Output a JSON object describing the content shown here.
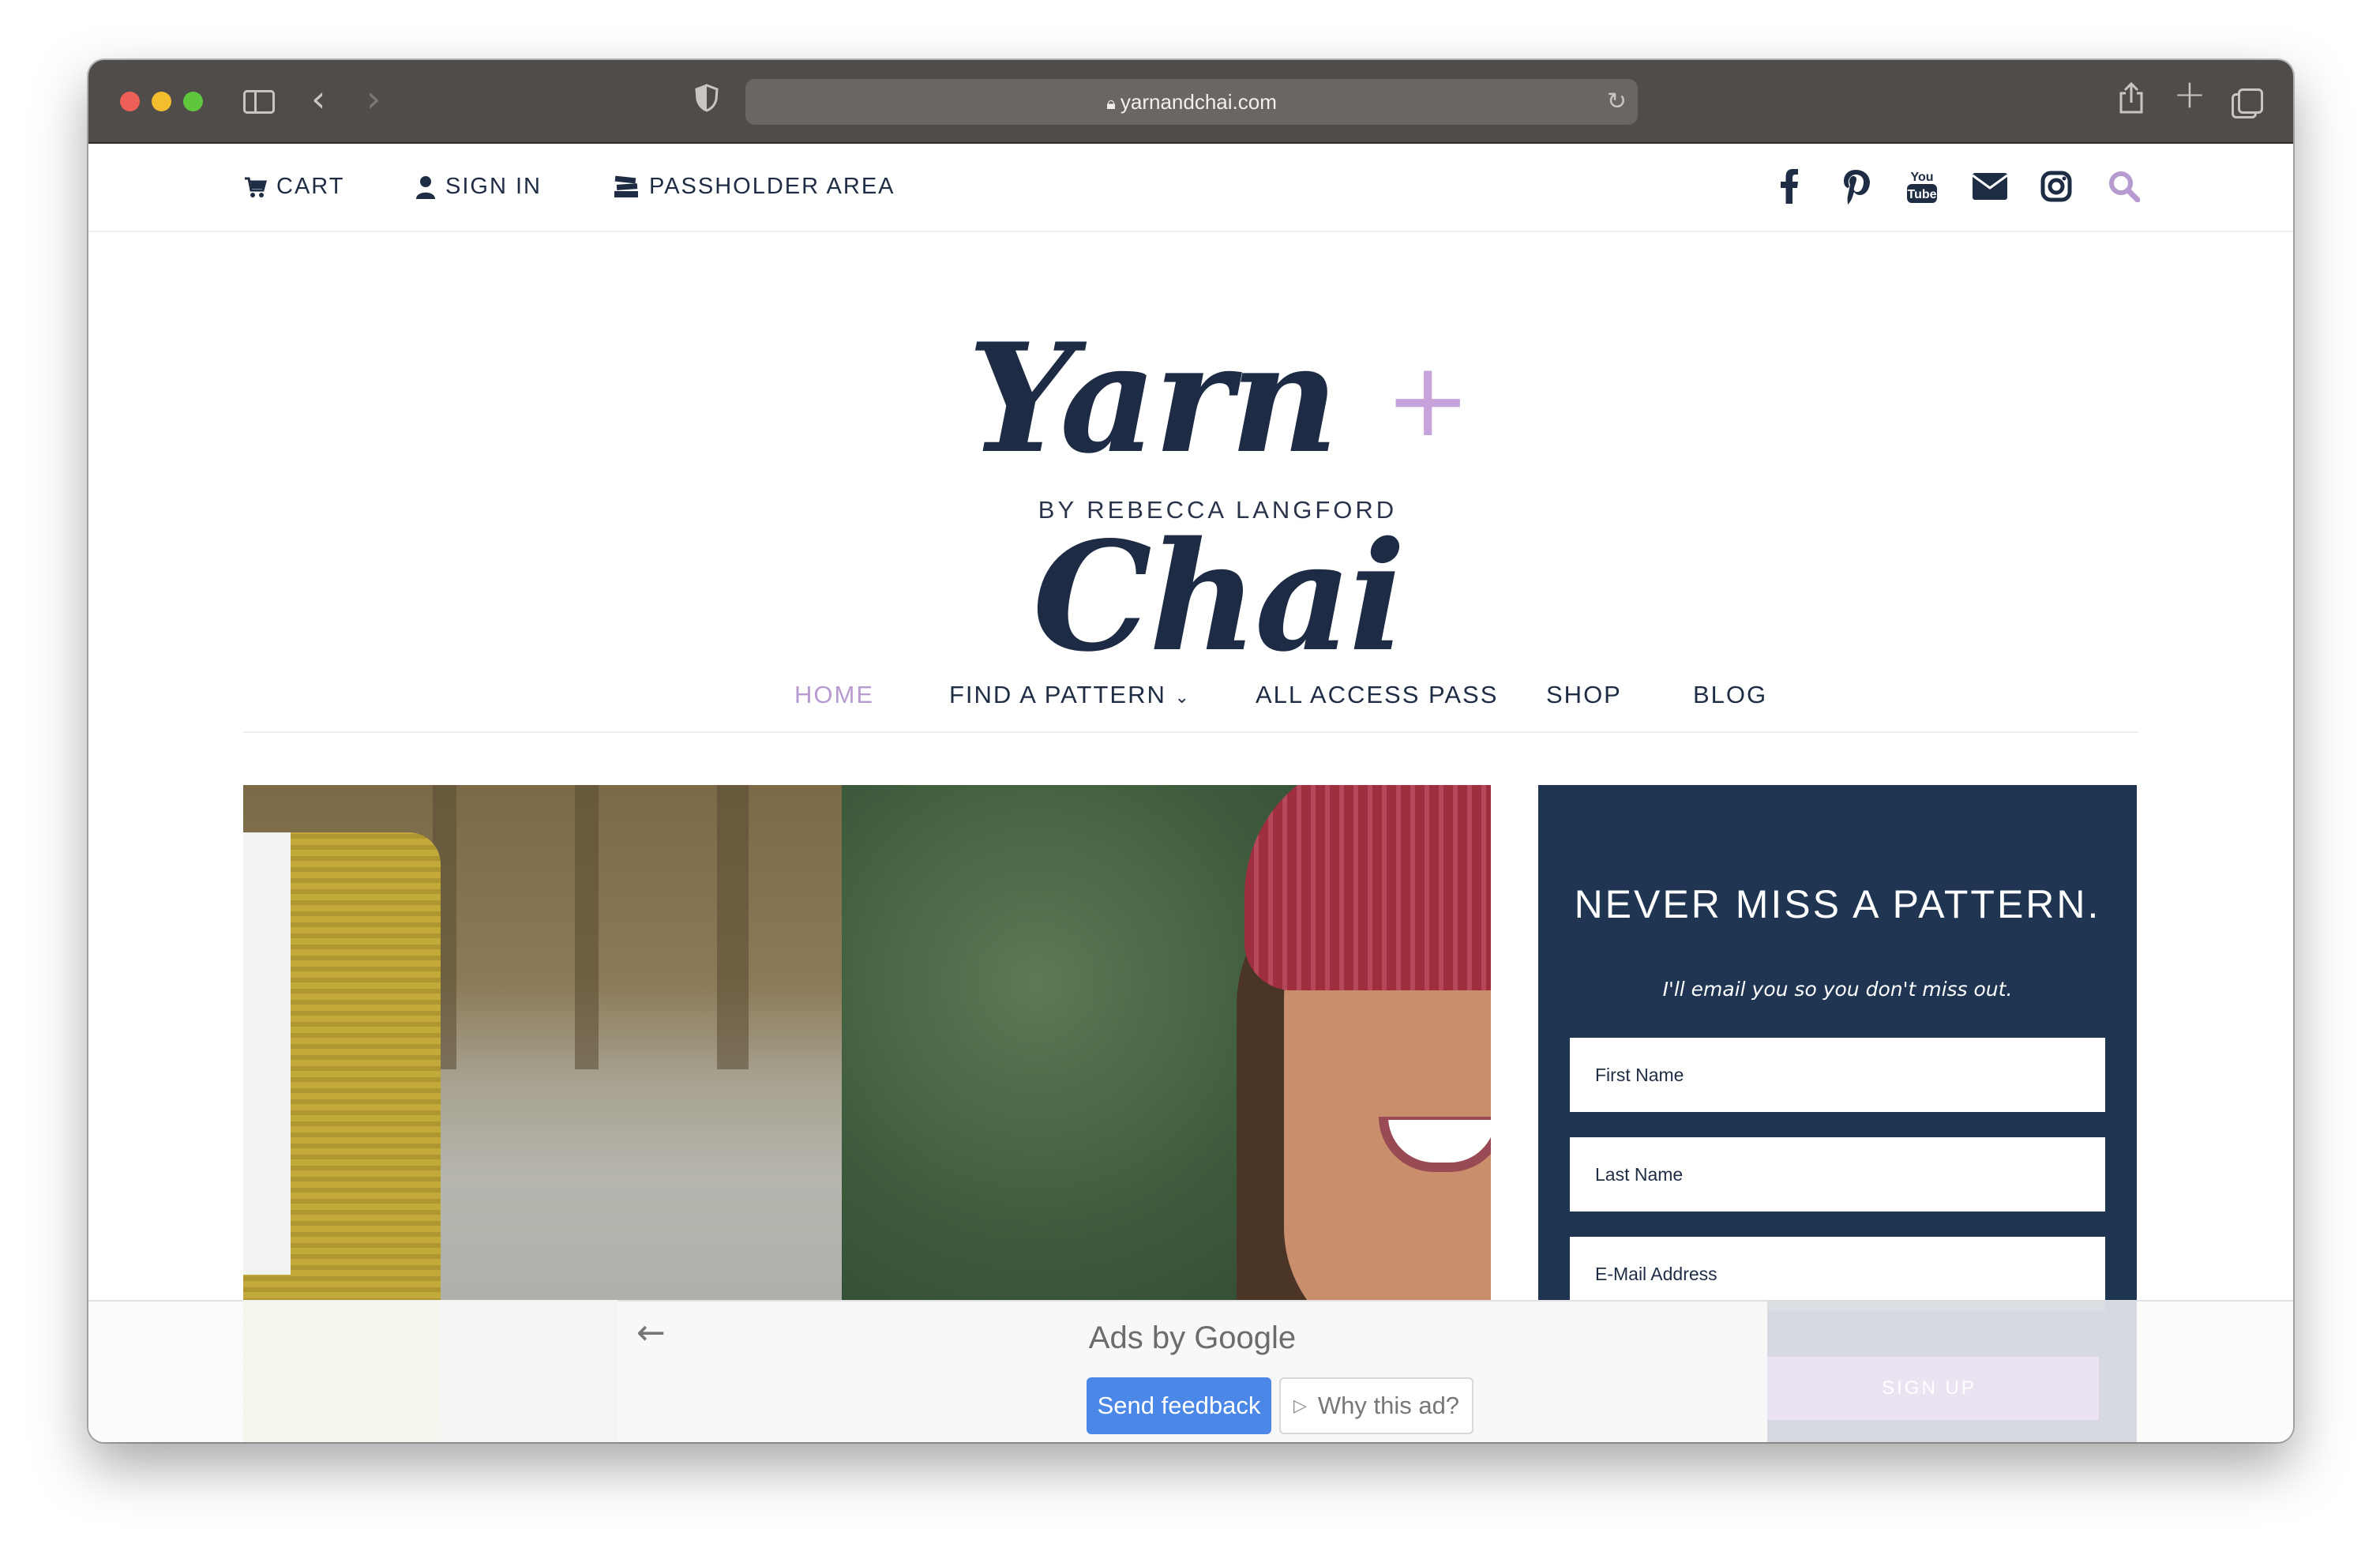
{
  "browser": {
    "url": "yarnandchai.com"
  },
  "topbar": {
    "cart": "CART",
    "sign_in": "SIGN IN",
    "passholder": "PASSHOLDER AREA",
    "social_icons": [
      "facebook-icon",
      "pinterest-icon",
      "youtube-icon",
      "email-icon",
      "instagram-icon",
      "search-icon"
    ]
  },
  "logo": {
    "title_left": "Yarn",
    "title_plus": "+",
    "title_right": "Chai",
    "subtitle": "BY REBECCA LANGFORD"
  },
  "nav": {
    "items": [
      {
        "label": "HOME",
        "active": true
      },
      {
        "label": "FIND A PATTERN",
        "dropdown": true
      },
      {
        "label": "ALL ACCESS PASS"
      },
      {
        "label": "SHOP"
      },
      {
        "label": "BLOG"
      }
    ]
  },
  "newsletter": {
    "title": "NEVER MISS A PATTERN.",
    "subtitle": "I'll email you so you don't miss out.",
    "first_name_placeholder": "First Name",
    "last_name_placeholder": "Last Name",
    "email_placeholder": "E-Mail Address",
    "submit": "SIGN UP"
  },
  "ad": {
    "ads_by": "Ads by Google",
    "send_feedback": "Send feedback",
    "why_this_ad": "Why this ad?"
  },
  "colors": {
    "navy": "#1f3552",
    "accent_lavender": "#b79ad0",
    "google_blue": "#4a87e6"
  }
}
